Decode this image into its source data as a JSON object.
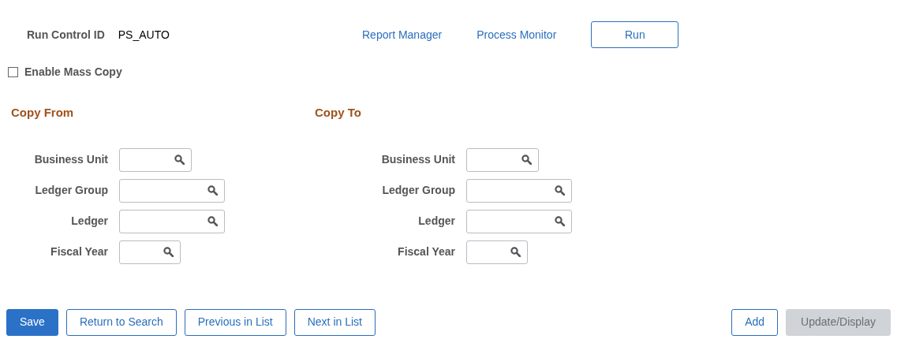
{
  "run_control": {
    "label": "Run Control ID",
    "value": "PS_AUTO"
  },
  "header_actions": [
    {
      "kind": "link",
      "label": "Report Manager"
    },
    {
      "kind": "link",
      "label": "Process Monitor"
    },
    {
      "kind": "button",
      "label": "Run"
    }
  ],
  "mass_copy": {
    "label": "Enable Mass Copy",
    "checked": false
  },
  "sections": [
    {
      "title": "Copy From",
      "fields": [
        {
          "label": "Business Unit"
        },
        {
          "label": "Ledger Group"
        },
        {
          "label": "Ledger"
        },
        {
          "label": "Fiscal Year"
        }
      ]
    },
    {
      "title": "Copy To",
      "fields": [
        {
          "label": "Business Unit"
        },
        {
          "label": "Ledger Group"
        },
        {
          "label": "Ledger"
        },
        {
          "label": "Fiscal Year"
        }
      ]
    }
  ],
  "toolbar_left": [
    {
      "label": "Save",
      "kind": "primary"
    },
    {
      "label": "Return to Search",
      "kind": "outline"
    },
    {
      "label": "Previous in List",
      "kind": "outline"
    },
    {
      "label": "Next in List",
      "kind": "outline"
    }
  ],
  "toolbar_right": [
    {
      "label": "Add",
      "kind": "outline"
    },
    {
      "label": "Update/Display",
      "kind": "disabled"
    }
  ]
}
